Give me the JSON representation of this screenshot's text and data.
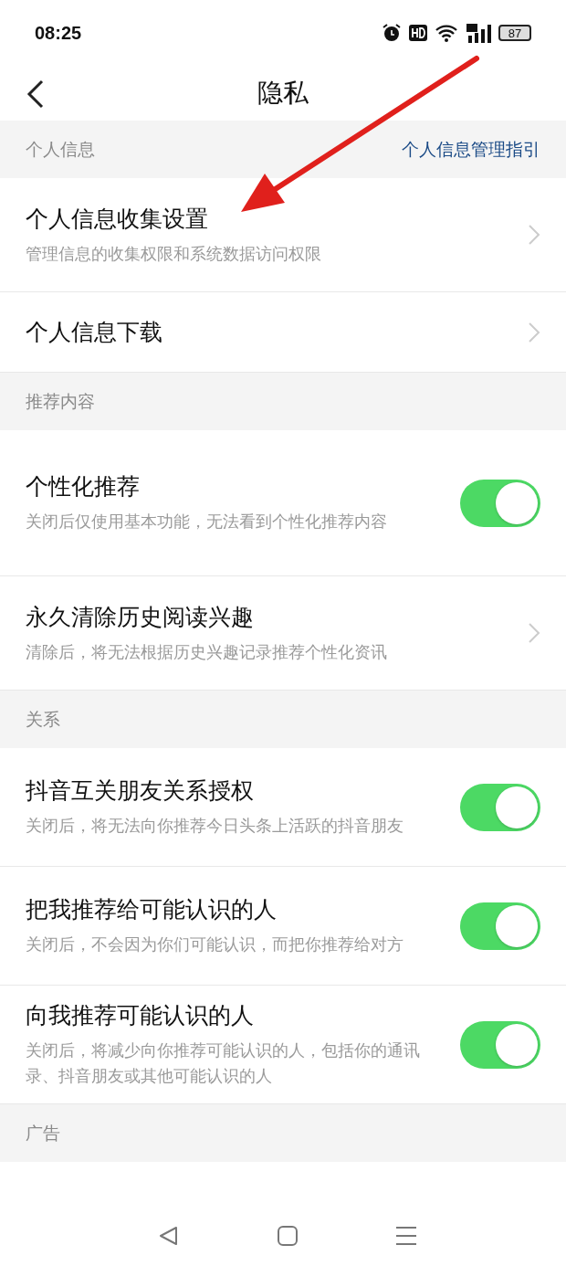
{
  "status_bar": {
    "time": "08:25",
    "battery": "87"
  },
  "header": {
    "title": "隐私"
  },
  "sections": [
    {
      "label": "个人信息",
      "link": "个人信息管理指引",
      "rows": [
        {
          "kind": "link",
          "title": "个人信息收集设置",
          "subtitle": "管理信息的收集权限和系统数据访问权限"
        },
        {
          "kind": "link",
          "title": "个人信息下载"
        }
      ]
    },
    {
      "label": "推荐内容",
      "rows": [
        {
          "kind": "toggle",
          "title": "个性化推荐",
          "subtitle": "关闭后仅使用基本功能，无法看到个性化推荐内容",
          "on": true
        },
        {
          "kind": "link",
          "title": "永久清除历史阅读兴趣",
          "subtitle": "清除后，将无法根据历史兴趣记录推荐个性化资讯"
        }
      ]
    },
    {
      "label": "关系",
      "rows": [
        {
          "kind": "toggle",
          "title": "抖音互关朋友关系授权",
          "subtitle": "关闭后，将无法向你推荐今日头条上活跃的抖音朋友",
          "on": true
        },
        {
          "kind": "toggle",
          "title": "把我推荐给可能认识的人",
          "subtitle": "关闭后，不会因为你们可能认识，而把你推荐给对方",
          "on": true
        },
        {
          "kind": "toggle",
          "title": "向我推荐可能认识的人",
          "subtitle": "关闭后，将减少向你推荐可能认识的人，包括你的通讯录、抖音朋友或其他可能认识的人",
          "on": true
        }
      ]
    },
    {
      "label": "广告",
      "rows": [
        {
          "kind": "clipped"
        }
      ]
    }
  ]
}
